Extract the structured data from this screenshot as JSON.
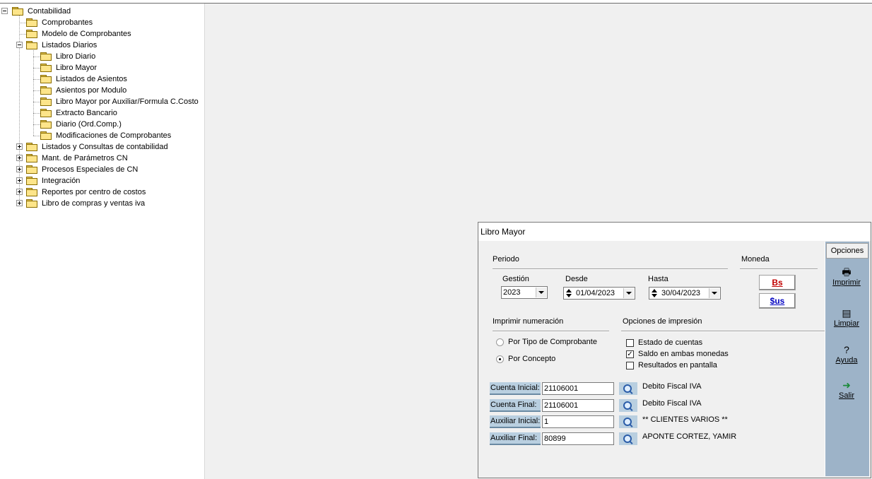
{
  "tree": {
    "root": "Contabilidad",
    "items": [
      {
        "label": "Comprobantes"
      },
      {
        "label": "Modelo de Comprobantes"
      },
      {
        "label": "Listados Diarios",
        "children": [
          "Libro Diario",
          "Libro Mayor",
          "Listados de Asientos",
          "Asientos por Modulo",
          "Libro Mayor por Auxiliar/Formula C.Costo",
          "Extracto Bancario",
          "Diario (Ord.Comp.)",
          "Modificaciones de Comprobantes"
        ]
      },
      {
        "label": "Listados y Consultas de contabilidad"
      },
      {
        "label": "Mant. de Parámetros CN"
      },
      {
        "label": "Procesos Especiales de CN"
      },
      {
        "label": "Integración"
      },
      {
        "label": "Reportes por centro de costos"
      },
      {
        "label": "Libro de compras y ventas iva"
      }
    ]
  },
  "dialog": {
    "title": "Libro Mayor",
    "periodo": {
      "heading": "Periodo",
      "gestion_label": "Gestión",
      "gestion_value": "2023",
      "desde_label": "Desde",
      "desde_value": "01/04/2023",
      "hasta_label": "Hasta",
      "hasta_value": "30/04/2023"
    },
    "moneda": {
      "heading": "Moneda",
      "bs_label": "Bs",
      "sus_label": "$us",
      "bs_color": "#c00000",
      "sus_color": "#0000c0"
    },
    "numeracion": {
      "heading": "Imprimir numeración",
      "options": [
        "Por Tipo de Comprobante",
        "Por Concepto"
      ],
      "selected": "Por Concepto"
    },
    "opciones_impresion": {
      "heading": "Opciones de impresión",
      "items": [
        {
          "label": "Estado de cuentas",
          "checked": false
        },
        {
          "label": "Saldo en ambas monedas",
          "checked": true
        },
        {
          "label": "Resultados en pantalla",
          "checked": false
        }
      ]
    },
    "cuentas": [
      {
        "label": "Cuenta Inicial:",
        "value": "21106001",
        "desc": "Debito Fiscal IVA"
      },
      {
        "label": "Cuenta Final:",
        "value": "21106001",
        "desc": "Debito Fiscal IVA"
      },
      {
        "label": "Auxiliar Inicial:",
        "value": "1",
        "desc": "** CLIENTES VARIOS **"
      },
      {
        "label": "Auxiliar Final:",
        "value": "80899",
        "desc": "APONTE CORTEZ, YAMIR"
      }
    ],
    "side": {
      "tab": "Opciones",
      "buttons": [
        {
          "label": "Imprimir",
          "icon": "printer-icon"
        },
        {
          "label": "Limpiar",
          "icon": "clean-icon"
        },
        {
          "label": "Ayuda",
          "icon": "help-icon"
        },
        {
          "label": "Salir",
          "icon": "exit-icon"
        }
      ]
    }
  }
}
